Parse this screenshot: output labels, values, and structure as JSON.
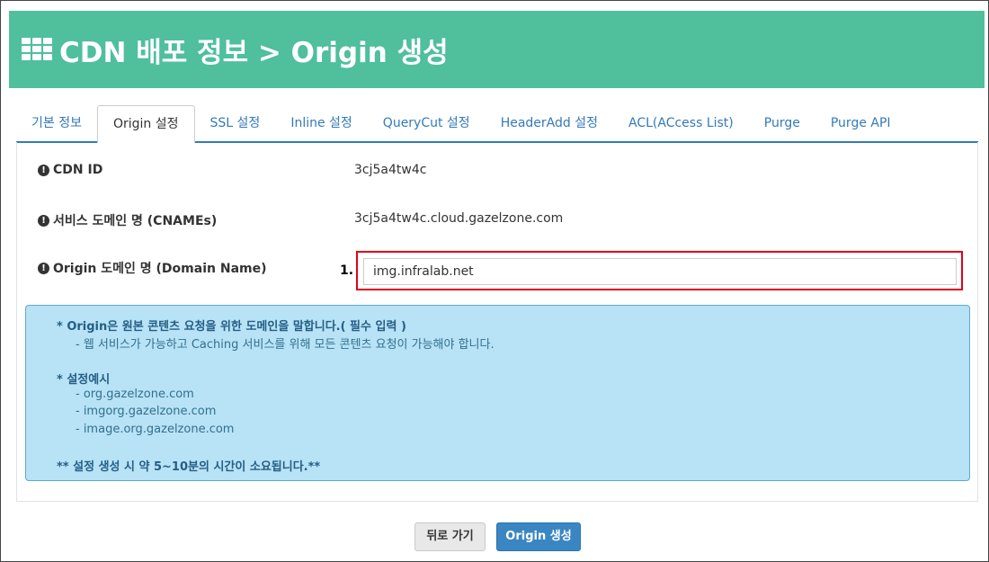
{
  "header": {
    "title": "CDN 배포 정보 > Origin 생성",
    "icon": "grid-icon",
    "bg_color": "#4fbf9c"
  },
  "tabs": [
    {
      "label": "기본 정보",
      "active": false
    },
    {
      "label": "Origin 설정",
      "active": true
    },
    {
      "label": "SSL 설정",
      "active": false
    },
    {
      "label": "Inline 설정",
      "active": false
    },
    {
      "label": "QueryCut 설정",
      "active": false
    },
    {
      "label": "HeaderAdd 설정",
      "active": false
    },
    {
      "label": "ACL(ACcess List)",
      "active": false
    },
    {
      "label": "Purge",
      "active": false
    },
    {
      "label": "Purge API",
      "active": false
    }
  ],
  "fields": {
    "cdn_id": {
      "label": "CDN ID",
      "value": "3cj5a4tw4c"
    },
    "cname": {
      "label": "서비스 도메인 명 (CNAMEs)",
      "value": "3cj5a4tw4c.cloud.gazelzone.com"
    },
    "origin_domain": {
      "label": "Origin 도메인 명 (Domain Name)",
      "value": "img.infralab.net",
      "step": "1."
    }
  },
  "notice": {
    "line1": "* Origin은 원본 콘텐츠 요청을 위한 도메인을 말합니다.( 필수 입력 )",
    "line2": "- 웹 서비스가 가능하고 Caching 서비스를 위해 모든 콘텐츠 요청이 가능해야 합니다.",
    "line3": "* 설정예시",
    "examples": [
      "- org.gazelzone.com",
      "- imgorg.gazelzone.com",
      "- image.org.gazelzone.com"
    ],
    "line4": "** 설정 생성 시 약 5~10분의 시간이 소요됩니다.**"
  },
  "buttons": {
    "back": "뒤로 가기",
    "create": "Origin 생성"
  },
  "colors": {
    "accent": "#337ab7",
    "highlight": "#e0001b",
    "notice_bg": "#b8e2f5",
    "primary_button": "#3a86c2"
  }
}
